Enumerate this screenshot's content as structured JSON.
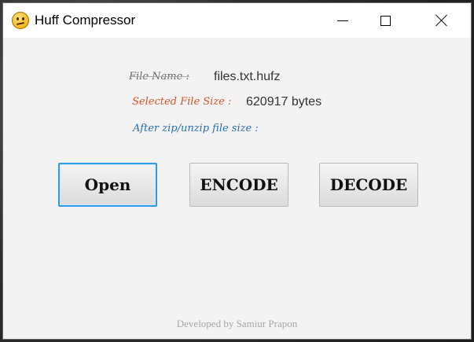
{
  "window": {
    "title": "Huff Compressor",
    "icon": "smiley-icon"
  },
  "fields": {
    "file_name_label": "File Name :",
    "file_name_value": "files.txt.hufz",
    "selected_size_label": "Selected File Size :",
    "selected_size_value": "620917 bytes",
    "after_size_label": "After zip/unzip file size :",
    "after_size_value": ""
  },
  "buttons": {
    "open": "Open",
    "encode": "ENCODE",
    "decode": "DECODE"
  },
  "footer": {
    "credit": "Developed by Samiur Prapon"
  },
  "colors": {
    "selected_size_label": "#d9542a",
    "after_size_label": "#2a6db5",
    "focus_border": "#2f9be6"
  }
}
